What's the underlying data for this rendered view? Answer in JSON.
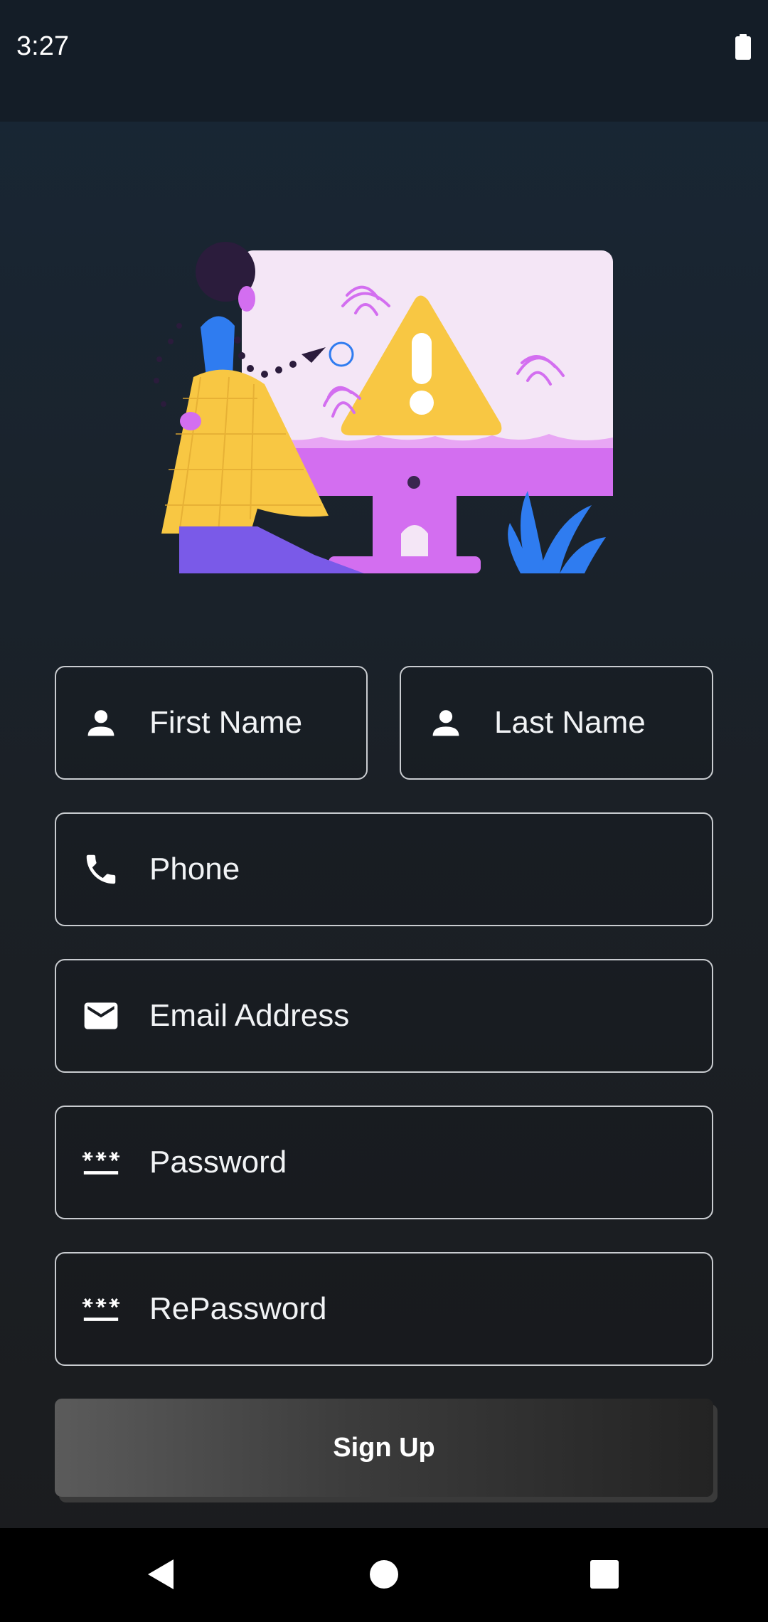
{
  "status_bar": {
    "time": "3:27",
    "battery_icon": "battery-full-icon"
  },
  "form": {
    "first_name": {
      "label": "First Name",
      "icon": "person-icon"
    },
    "last_name": {
      "label": "Last Name",
      "icon": "person-icon"
    },
    "phone": {
      "label": "Phone",
      "icon": "phone-icon"
    },
    "email": {
      "label": "Email Address",
      "icon": "mail-icon"
    },
    "password": {
      "label": "Password",
      "icon": "password-icon"
    },
    "repassword": {
      "label": "RePassword",
      "icon": "password-icon"
    },
    "submit_label": "Sign Up"
  },
  "nav": {
    "back_icon": "back-triangle-icon",
    "home_icon": "home-circle-icon",
    "recents_icon": "recents-square-icon"
  },
  "colors": {
    "accent_pink": "#d36ef0",
    "accent_yellow": "#f8c743",
    "accent_blue": "#2f7cf0",
    "field_border": "#c9ccd0"
  }
}
